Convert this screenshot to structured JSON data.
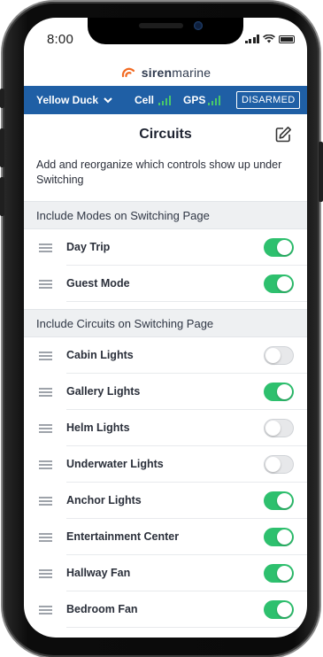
{
  "status_bar": {
    "time": "8:00"
  },
  "brand": {
    "name_bold": "siren",
    "name_rest": "marine",
    "accent_color": "#f26a21"
  },
  "vessel_bar": {
    "vessel_name": "Yellow Duck",
    "cell_label": "Cell",
    "gps_label": "GPS",
    "armed_status": "DISARMED",
    "background_color": "#1f5fa5",
    "signal_color": "#49c86a"
  },
  "page": {
    "title": "Circuits",
    "description": "Add and reorganize which controls show up under Switching"
  },
  "modes_section": {
    "header": "Include Modes on Switching Page",
    "items": [
      {
        "label": "Day Trip",
        "enabled": true
      },
      {
        "label": "Guest Mode",
        "enabled": true
      }
    ]
  },
  "circuits_section": {
    "header": "Include Circuits on Switching Page",
    "items": [
      {
        "label": "Cabin Lights",
        "enabled": false
      },
      {
        "label": "Gallery Lights",
        "enabled": true
      },
      {
        "label": "Helm Lights",
        "enabled": false
      },
      {
        "label": "Underwater Lights",
        "enabled": false
      },
      {
        "label": "Anchor Lights",
        "enabled": true
      },
      {
        "label": "Entertainment Center",
        "enabled": true
      },
      {
        "label": "Hallway Fan",
        "enabled": true
      },
      {
        "label": "Bedroom Fan",
        "enabled": true
      }
    ]
  },
  "colors": {
    "toggle_on": "#2ec06e",
    "toggle_off": "#e7e8ea"
  }
}
